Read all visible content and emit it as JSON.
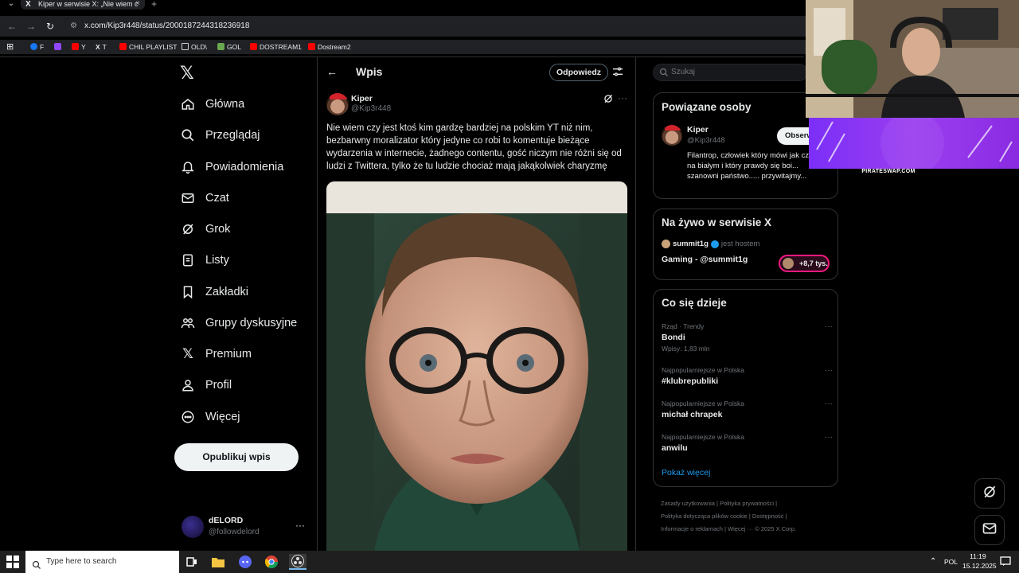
{
  "browser": {
    "tab_title": "Kiper w serwisie X: „Nie wiem c",
    "url": "x.com/Kip3r448/status/2000187244318236918",
    "bookmarks": [
      {
        "label": "F",
        "color": "#1877f2"
      },
      {
        "label": "",
        "color": "#9146ff"
      },
      {
        "label": "Y",
        "color": "#ff0000"
      },
      {
        "label": "T",
        "color": "#000000"
      },
      {
        "label": "CHIL PLAYLIST",
        "color": "#ff0000"
      },
      {
        "label": "OLD\\",
        "color": "folder"
      },
      {
        "label": "GOL",
        "color": "#6aa84f"
      },
      {
        "label": "DOSTREAM1",
        "color": "#ff0000"
      },
      {
        "label": "Dostream2",
        "color": "#ff0000"
      }
    ]
  },
  "nav": {
    "items": [
      {
        "label": "Główna",
        "icon": "home-icon"
      },
      {
        "label": "Przeglądaj",
        "icon": "search-icon"
      },
      {
        "label": "Powiadomienia",
        "icon": "bell-icon"
      },
      {
        "label": "Czat",
        "icon": "mail-icon"
      },
      {
        "label": "Grok",
        "icon": "grok-icon"
      },
      {
        "label": "Listy",
        "icon": "list-icon"
      },
      {
        "label": "Zakładki",
        "icon": "bookmark-icon"
      },
      {
        "label": "Grupy dyskusyjne",
        "icon": "communities-icon"
      },
      {
        "label": "Premium",
        "icon": "x-icon"
      },
      {
        "label": "Profil",
        "icon": "person-icon"
      },
      {
        "label": "Więcej",
        "icon": "more-circle-icon"
      }
    ],
    "post_button": "Opublikuj wpis",
    "account": {
      "name": "dELORD",
      "handle": "@followdelord",
      "more": "···"
    }
  },
  "main": {
    "back": "←",
    "title": "Wpis",
    "reply_button": "Odpowiedz",
    "post": {
      "name": "Kiper",
      "handle": "@Kip3r448",
      "more": "···",
      "text": "Nie wiem czy jest ktoś kim gardzę bardziej na polskim YT niż nim, bezbarwny moralizator który jedyne co robi to komentuje bieżące wydarzenia w internecie, żadnego contentu, gość niczym nie różni się od ludzi z Twittera, tylko że tu ludzie chociaż mają jakąkolwiek charyzmę"
    }
  },
  "sidebar": {
    "search_placeholder": "Szukaj",
    "related": {
      "title": "Powiązane osoby",
      "name": "Kiper",
      "handle": "@Kip3r448",
      "follow": "Obserwuj",
      "bio": "Filantrop, człowiek który mówi jak czarno na białym i który prawdy się boi... szanowni państwo..... przywitajmy..."
    },
    "live": {
      "title": "Na żywo w serwisie X",
      "host": "summit1g",
      "host_suffix": "jest hostem",
      "stream_title": "Gaming - @summit1g",
      "listeners": "+8,7 tys."
    },
    "trends": {
      "title": "Co się dzieje",
      "items": [
        {
          "meta": "Rząd · Trendy",
          "name": "Bondi",
          "posts": "Wpisy: 1,83 mln"
        },
        {
          "meta": "Najpopularniejsze w Polska",
          "name": "#klubrepubliki",
          "posts": ""
        },
        {
          "meta": "Najpopularniejsze w Polska",
          "name": "michał chrapek",
          "posts": ""
        },
        {
          "meta": "Najpopularniejsze w Polska",
          "name": "anwilu",
          "posts": ""
        }
      ],
      "show_more": "Pokaż więcej"
    },
    "footer": {
      "line1": "Zasady użytkowania  |  Polityka prywatności  |",
      "line2": "Polityka dotycząca plików cookie  |  Dostępność  |",
      "line3": "Informacje o reklamach  |  Więcej ···  © 2025 X Corp."
    }
  },
  "overlay": {
    "promo_label": "PIRATESWAP.COM"
  },
  "taskbar": {
    "search_placeholder": "Type here to search",
    "language": "POL",
    "time": "11:19",
    "date": "15.12.2025"
  }
}
